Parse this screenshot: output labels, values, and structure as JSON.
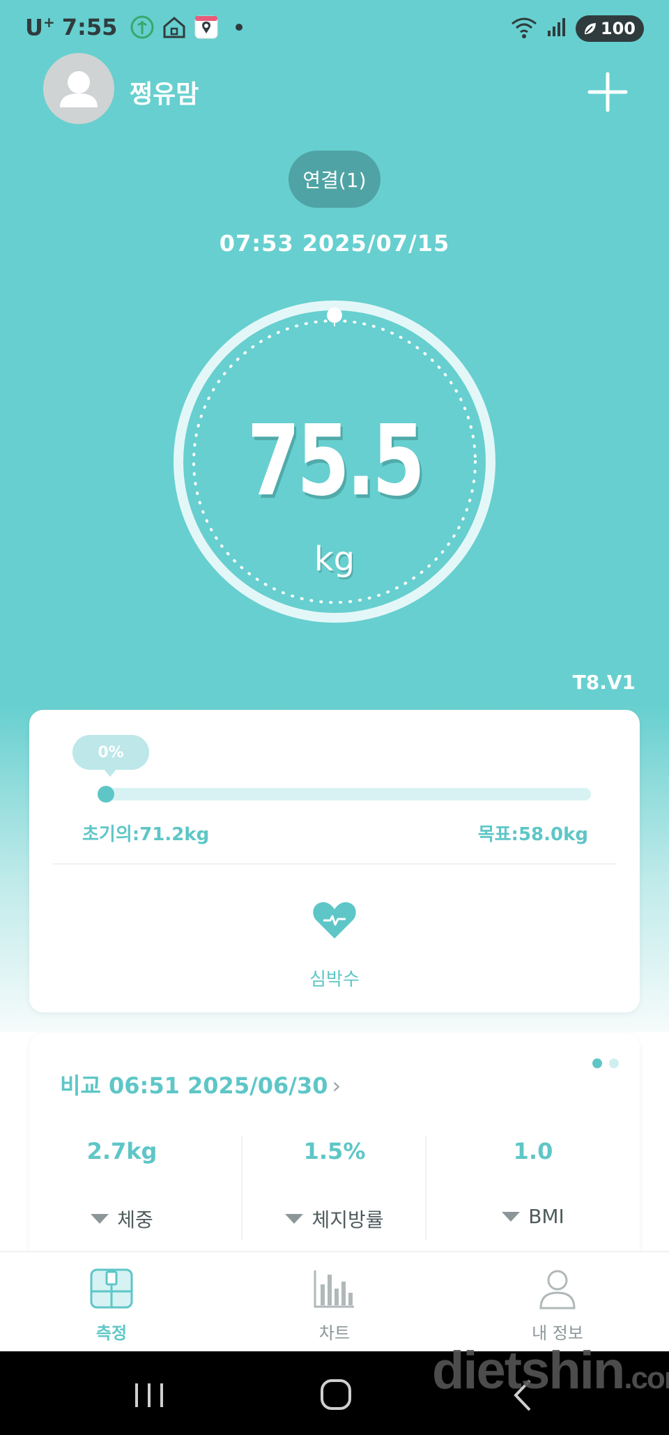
{
  "status_bar": {
    "carrier": "U",
    "carrier_sup": "+",
    "time": "7:55",
    "battery": "100"
  },
  "header": {
    "username": "쩡유맘"
  },
  "device": {
    "connect_label": "연결(1)",
    "timestamp": "07:53 2025/07/15",
    "weight": "75.5",
    "unit": "kg",
    "version": "T8.V1"
  },
  "goal": {
    "progress_label": "0%",
    "progress_fraction": 0.0,
    "initial": "초기의:71.2kg",
    "target": "목표:58.0kg",
    "heart_rate_label": "심박수"
  },
  "compare": {
    "title": "비교 06:51 2025/06/30",
    "chevron": "›",
    "stats": [
      {
        "value": "2.7kg",
        "name": "체중"
      },
      {
        "value": "1.5%",
        "name": "체지방률"
      },
      {
        "value": "1.0",
        "name": "BMI"
      }
    ]
  },
  "tabs": [
    {
      "label": "측정",
      "icon": "scale-icon",
      "active": true
    },
    {
      "label": "차트",
      "icon": "bar-chart-icon",
      "active": false
    },
    {
      "label": "내 정보",
      "icon": "person-icon",
      "active": false
    }
  ],
  "watermark": {
    "main": "dietshin",
    "suffix": ".com"
  },
  "colors": {
    "accent": "#67cfcf",
    "accent_text": "#5ec6c7",
    "connect_bg": "#4fa3a4"
  }
}
